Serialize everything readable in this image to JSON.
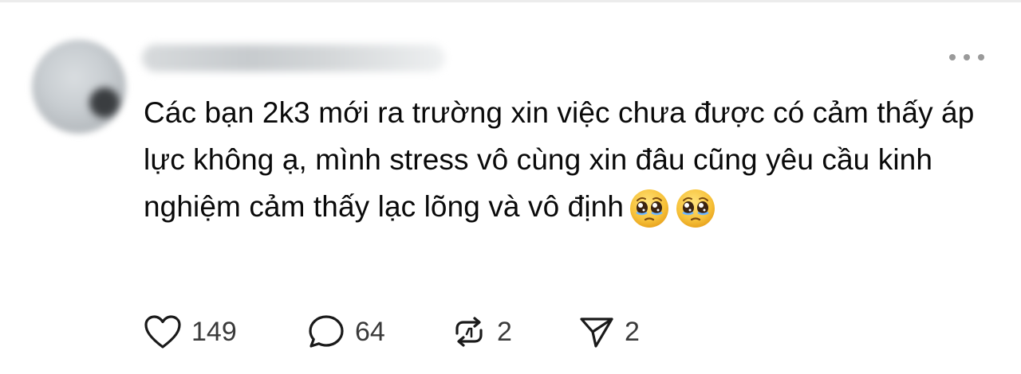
{
  "post": {
    "username": "",
    "text": "Các bạn 2k3 mới ra trường xin việc chưa được có cảm thấy áp lực không ạ, mình stress vô cùng xin đâu cũng yêu cầu kinh nghiệm cảm thấy lạc lõng và vô định",
    "emojis": [
      "pleading-face-emoji",
      "pleading-face-emoji"
    ]
  },
  "actions": {
    "likes": "149",
    "comments": "64",
    "reposts": "2",
    "shares": "2"
  },
  "icons": {
    "more": "more-horizontal-icon",
    "like": "heart-icon",
    "comment": "comment-bubble-icon",
    "repost": "repost-icon",
    "share": "send-icon"
  },
  "colors": {
    "text": "#0a0a0a",
    "muted": "#9a9a9a",
    "emoji_face": "#f7c23a"
  }
}
